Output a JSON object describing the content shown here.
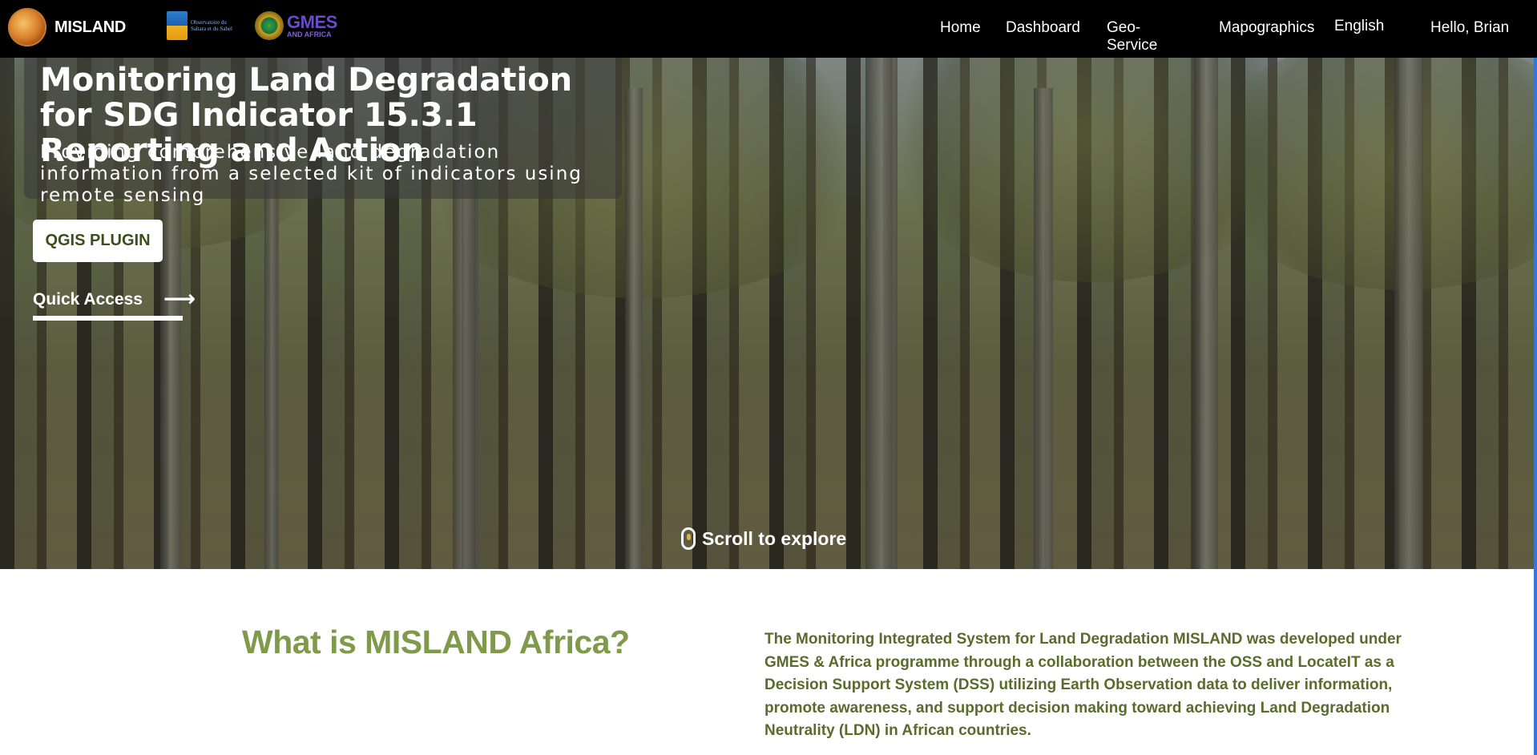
{
  "brand": {
    "name": "MISLAND"
  },
  "partners": {
    "oss_text": "Observatoire du Sahara et du Sahel",
    "gmes_title": "GMES",
    "gmes_subtitle": "AND AFRICA"
  },
  "nav": {
    "home": "Home",
    "dashboard": "Dashboard",
    "geo_service": "Geo-Service",
    "mapographics": "Mapographics",
    "language": "English",
    "user_greeting": "Hello, Brian"
  },
  "hero": {
    "title": "Monitoring Land Degradation for SDG Indicator 15.3.1 Reporting and Action",
    "subtitle": "Providing comprehensive land degradation information from a selected kit of indicators using remote sensing",
    "qgis_button": "QGIS PLUGIN",
    "quick_access": "Quick Access",
    "scroll_hint": "Scroll to explore"
  },
  "about": {
    "heading": "What is MISLAND Africa?",
    "body": "The Monitoring Integrated System for Land Degradation MISLAND was developed under GMES & Africa programme through a collaboration between the OSS and LocateIT as a Decision Support System (DSS) utilizing Earth Observation data to deliver information, promote awareness, and support decision making toward achieving Land Degradation Neutrality (LDN) in African countries."
  },
  "colors": {
    "nav_bg": "#000000",
    "accent_green": "#7f9a4a",
    "body_green": "#5a6b2c",
    "qgis_text": "#3d4d1c"
  },
  "icons": {
    "arrow": "right-arrow-icon",
    "mouse": "mouse-scroll-icon"
  }
}
